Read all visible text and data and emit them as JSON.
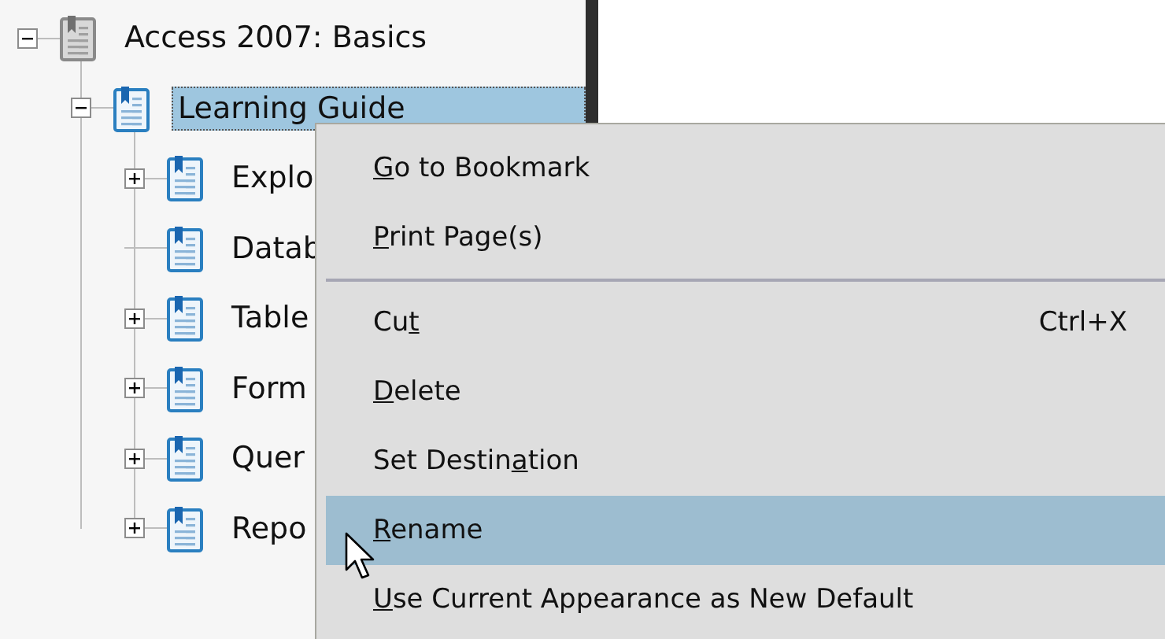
{
  "tree": {
    "label": "Access 2007: Basics",
    "kind": "root",
    "expanded": true,
    "selected": false,
    "children": [
      {
        "label": "Learning Guide",
        "kind": "folder",
        "expanded": true,
        "selected": true,
        "children": [
          {
            "label": "Explo",
            "kind": "folder",
            "expanded": false,
            "selected": false
          },
          {
            "label": "Datab",
            "kind": "leaf",
            "selected": false
          },
          {
            "label": "Table",
            "kind": "folder",
            "expanded": false,
            "selected": false
          },
          {
            "label": "Form",
            "kind": "folder",
            "expanded": false,
            "selected": false
          },
          {
            "label": "Quer",
            "kind": "folder",
            "expanded": false,
            "selected": false
          },
          {
            "label": "Repo",
            "kind": "folder",
            "expanded": false,
            "selected": false
          }
        ]
      }
    ]
  },
  "context_menu": {
    "items": [
      {
        "kind": "item",
        "key": "G",
        "after": "o to Bookmark",
        "selected": false
      },
      {
        "kind": "item",
        "key": "P",
        "after": "rint Page(s)",
        "selected": false
      },
      {
        "kind": "separator"
      },
      {
        "kind": "item",
        "before": "Cu",
        "key": "t",
        "shortcut": "Ctrl+X",
        "selected": false
      },
      {
        "kind": "item",
        "key": "D",
        "after": "elete",
        "selected": false
      },
      {
        "kind": "item",
        "before": "Set Destin",
        "key": "a",
        "after": "tion",
        "selected": false
      },
      {
        "kind": "item",
        "key": "R",
        "after": "ename",
        "selected": true
      },
      {
        "kind": "item",
        "key": "U",
        "after": "se Current Appearance as New Default",
        "selected": false
      }
    ]
  }
}
